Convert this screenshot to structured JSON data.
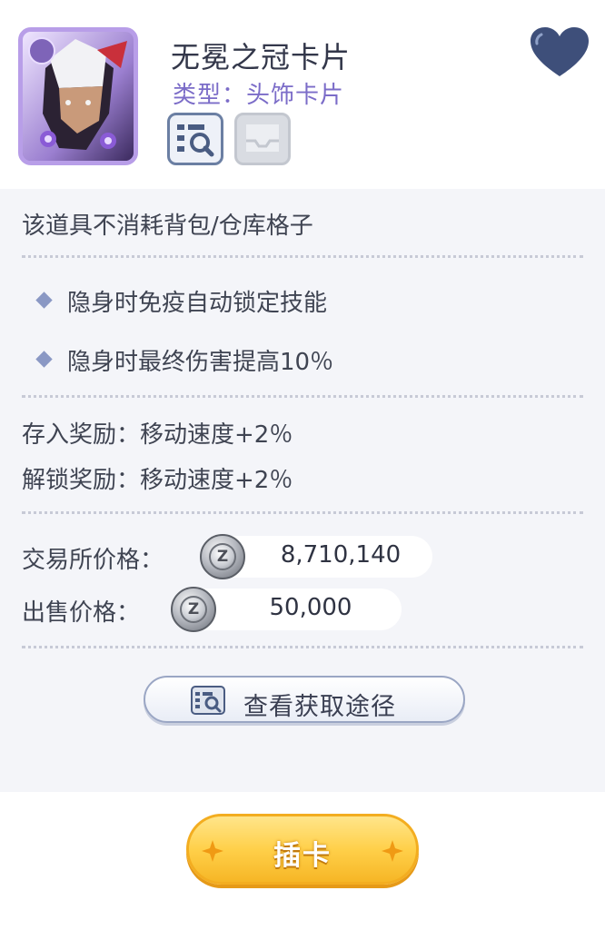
{
  "item": {
    "name": "无冕之冠卡片",
    "type_label": "类型：头饰卡片"
  },
  "icons": {
    "info": "item-info-icon",
    "storage": "storage-tray-icon",
    "favorite": "heart-icon",
    "currency": "zeny-coin-icon",
    "currency_glyph": "Z"
  },
  "notice": "该道具不消耗背包/仓库格子",
  "effects": [
    "隐身时免疫自动锁定技能",
    "隐身时最终伤害提高10％"
  ],
  "rewards": {
    "deposit": "存入奖励：移动速度+2％",
    "unlock": "解锁奖励：移动速度+2％"
  },
  "prices": {
    "exchange_label": "交易所价格：",
    "exchange_value": "8,710,140",
    "sell_label": "出售价格：",
    "sell_value": "50,000"
  },
  "buttons": {
    "source_label": "查看获取途径",
    "insert_label": "插卡"
  },
  "colors": {
    "accent_purple": "#7b6cc8",
    "heart": "#3e4f7a",
    "insert_button": "#ffd04a",
    "panel_bg": "#f4f5f9"
  }
}
